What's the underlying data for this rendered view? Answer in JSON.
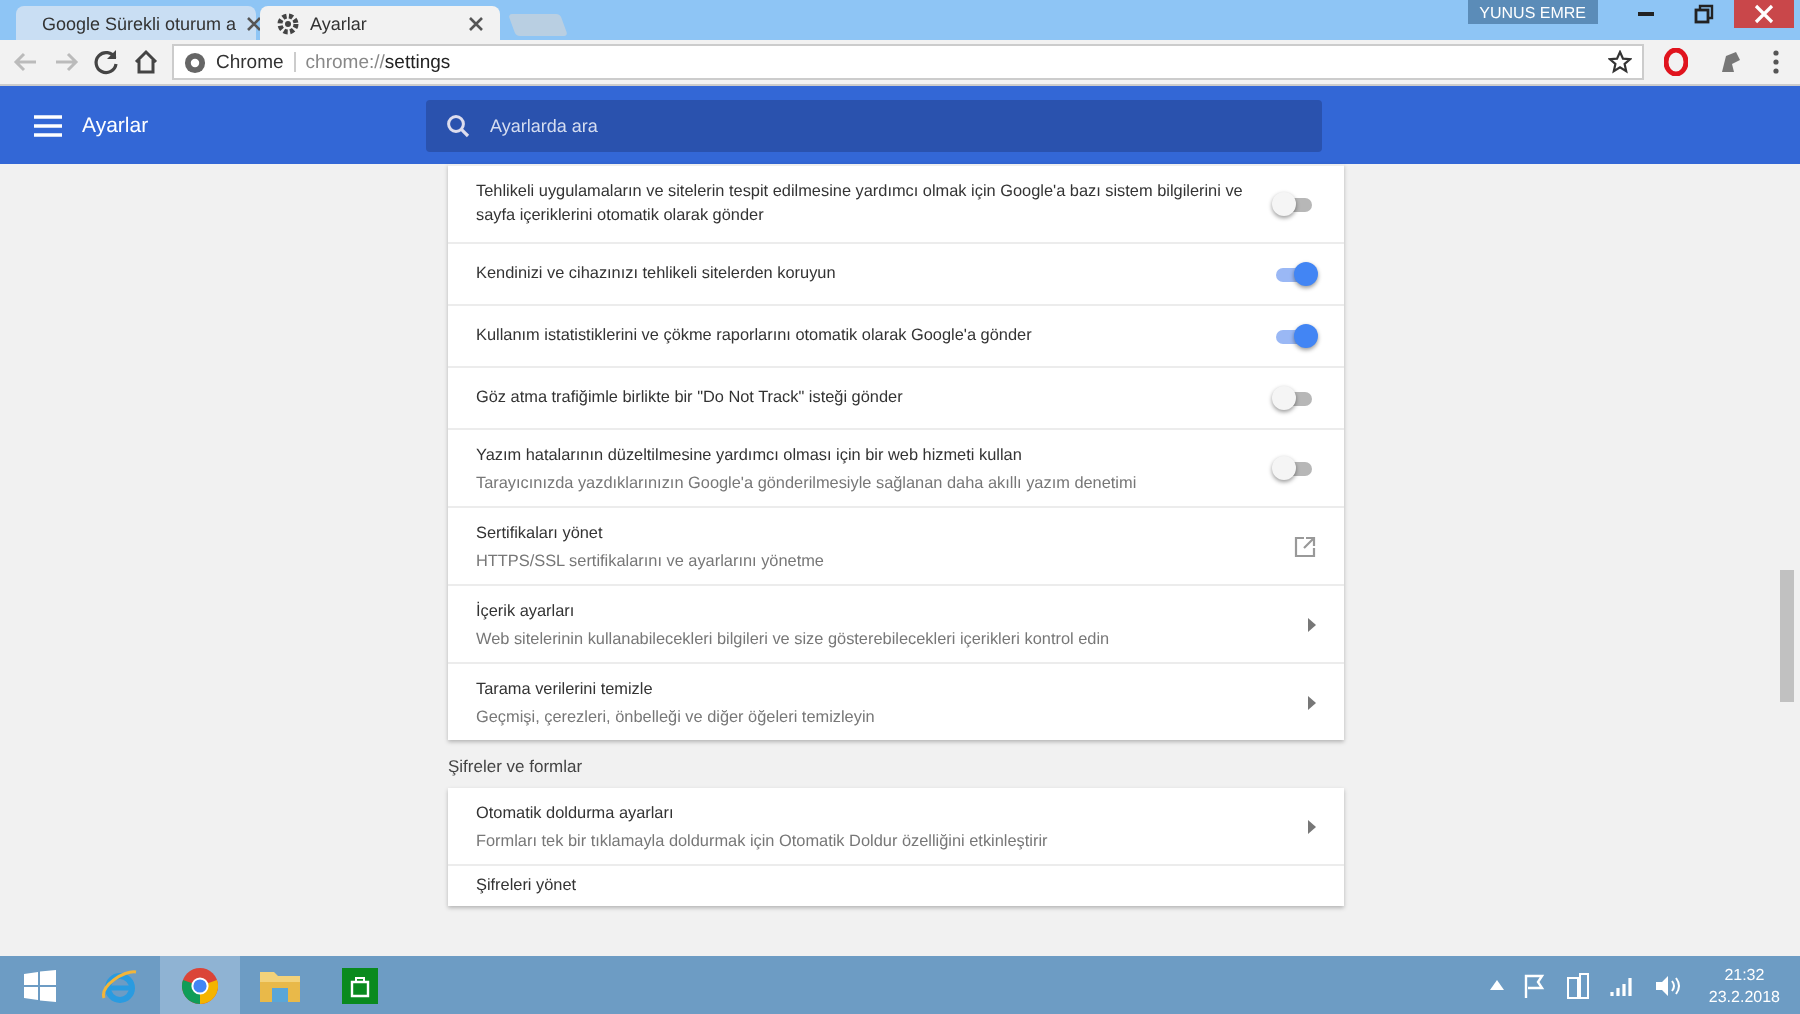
{
  "window": {
    "user": "YUNUS EMRE"
  },
  "tabs": [
    {
      "title": "Google Sürekli oturum a",
      "selected": false
    },
    {
      "title": "Ayarlar",
      "selected": true
    }
  ],
  "address_bar": {
    "site": "Chrome",
    "url_scheme": "chrome://",
    "url_path": "settings"
  },
  "header": {
    "title": "Ayarlar",
    "search": {
      "placeholder": "Ayarlarda ara"
    }
  },
  "sections": [
    {
      "rows": [
        {
          "kind": "toggle",
          "title": "Tehlikeli uygulamaların ve sitelerin tespit edilmesine yardımcı olmak için Google'a bazı sistem bilgilerini ve sayfa içeriklerini otomatik olarak gönder",
          "on": false
        },
        {
          "kind": "toggle",
          "title": "Kendinizi ve cihazınızı tehlikeli sitelerden koruyun",
          "on": true
        },
        {
          "kind": "toggle",
          "title": "Kullanım istatistiklerini ve çökme raporlarını otomatik olarak Google'a gönder",
          "on": true
        },
        {
          "kind": "toggle",
          "title": "Göz atma trafiğimle birlikte bir \"Do Not Track\" isteği gönder",
          "on": false
        },
        {
          "kind": "toggle",
          "title": "Yazım hatalarının düzeltilmesine yardımcı olması için bir web hizmeti kullan",
          "subtitle": "Tarayıcınızda yazdıklarınızın Google'a gönderilmesiyle sağlanan daha akıllı yazım denetimi",
          "on": false
        },
        {
          "kind": "external",
          "title": "Sertifikaları yönet",
          "subtitle": "HTTPS/SSL sertifikalarını ve ayarlarını yönetme"
        },
        {
          "kind": "submenu",
          "title": "İçerik ayarları",
          "subtitle": "Web sitelerinin kullanabilecekleri bilgileri ve size gösterebilecekleri içerikleri kontrol edin"
        },
        {
          "kind": "submenu",
          "title": "Tarama verilerini temizle",
          "subtitle": "Geçmişi, çerezleri, önbelleği ve diğer öğeleri temizleyin"
        }
      ]
    },
    {
      "heading": "Şifreler ve formlar",
      "rows": [
        {
          "kind": "submenu",
          "title": "Otomatik doldurma ayarları",
          "subtitle": "Formları tek bir tıklamayla doldurmak için Otomatik Doldur özelliğini etkinleştirir"
        },
        {
          "kind": "plain",
          "title": "Şifreleri yönet"
        }
      ]
    }
  ],
  "taskbar": {
    "apps": [
      {
        "kind": "ie",
        "selected": false
      },
      {
        "kind": "chrome",
        "selected": true
      },
      {
        "kind": "folder",
        "selected": false
      },
      {
        "kind": "store",
        "selected": false
      }
    ],
    "time": "21:32",
    "date": "23.2.2018"
  }
}
